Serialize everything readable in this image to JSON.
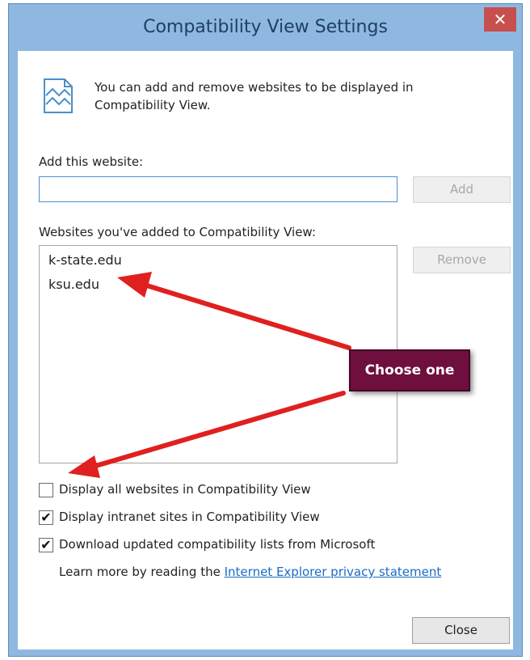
{
  "dialog": {
    "title": "Compatibility View Settings",
    "close_glyph": "✕",
    "info_text": "You can add and remove websites to be displayed in Compatibility View.",
    "add_label": "Add this website:",
    "add_input_value": "",
    "add_button": "Add",
    "list_label": "Websites you've added to Compatibility View:",
    "sites": [
      "k-state.edu",
      "ksu.edu"
    ],
    "remove_button": "Remove",
    "options": [
      {
        "label": "Display all websites in Compatibility View",
        "checked": false
      },
      {
        "label": "Display intranet sites in Compatibility View",
        "checked": true
      },
      {
        "label": "Download updated compatibility lists from Microsoft",
        "checked": true
      }
    ],
    "learn_more_prefix": "Learn more by reading the",
    "privacy_link": "Internet Explorer privacy statement",
    "close_button": "Close",
    "checkmark": "✔"
  },
  "annotation": {
    "callout_text": "Choose one",
    "callout_color": "#6f0f3d",
    "arrow_color": "#e02020"
  },
  "colors": {
    "frame": "#8fb8e0",
    "close_button": "#c7504f",
    "link": "#1a6bc7"
  }
}
